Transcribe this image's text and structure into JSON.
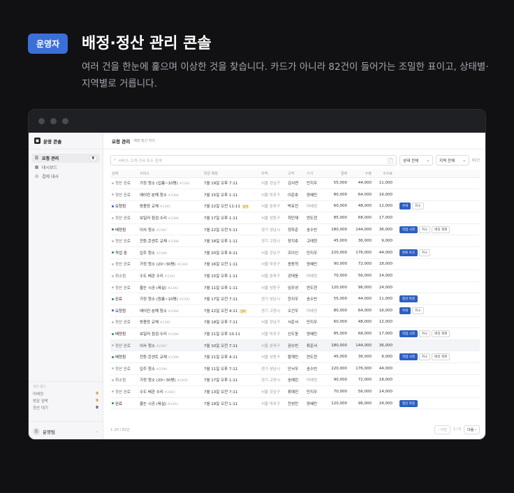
{
  "header": {
    "badge": "운영자",
    "title": "배정·정산 관리 콘솔",
    "subtitle": "여러 건을 한눈에 훑으며 이상한 것을 찾습니다. 카드가 아니라 82건이 들어가는 조밀한 표이고, 상태별·지역별로 거릅니다."
  },
  "sidebar": {
    "brand": "운영 콘솔",
    "items": [
      {
        "label": "요청 관리",
        "icon": "☰",
        "count": "9",
        "active": true
      },
      {
        "label": "대시보드",
        "icon": "▦",
        "count": "",
        "active": false
      },
      {
        "label": "결제 대사",
        "icon": "◎",
        "count": "",
        "active": false
      }
    ],
    "stats_title": "처리 대기",
    "stats": [
      {
        "label": "미배정",
        "value": "9",
        "color": "#c58a10"
      },
      {
        "label": "방문 임박",
        "value": "9",
        "color": "#c58a10"
      },
      {
        "label": "정산 대기",
        "value": "8",
        "color": "#333333"
      }
    ],
    "user": "운영팀"
  },
  "main": {
    "title": "요청 관리",
    "subtitle": "배정·정산 처리",
    "search_placeholder": "서비스·고객·기사·주소 검색",
    "search_kbd": "/",
    "status_filter": "상태 전체",
    "region_filter": "지역 전체",
    "count": "82건",
    "columns": [
      "상태",
      "서비스",
      "방문 예정",
      "지역",
      "고객",
      "기사",
      "결제",
      "수령",
      "수수료",
      ""
    ],
    "rows": [
      {
        "status": "정산 완료",
        "tone": "grey",
        "service": "가정 청소 (입룸~10평)",
        "id": "#2381",
        "visit": "7월 19일 오후 7:11",
        "urgent": "",
        "region": "서울 강남구",
        "customer": "김서연",
        "tech": "민지우",
        "pay": "55,000",
        "recv": "44,000",
        "fee": "11,000",
        "actions": []
      },
      {
        "status": "정산 완료",
        "tone": "grey",
        "service": "에어컨 분해 청소",
        "id": "#2384",
        "visit": "7월 15일 오후 1:11",
        "urgent": "",
        "region": "서울 마포구",
        "customer": "이준호",
        "tech": "양혜민",
        "pay": "80,000",
        "recv": "64,000",
        "fee": "16,000",
        "actions": []
      },
      {
        "status": "요청됨",
        "tone": "blue",
        "service": "방충망 교체",
        "id": "#2385",
        "visit": "7월 22일 오전 11:11",
        "urgent": "임박",
        "region": "서울 송파구",
        "customer": "박유진",
        "tech": "미배정",
        "pay": "60,000",
        "recv": "48,000",
        "fee": "12,000",
        "actions": [
          {
            "label": "수락",
            "primary": true
          },
          {
            "label": "취소",
            "primary": false
          }
        ]
      },
      {
        "status": "정산 완료",
        "tone": "grey",
        "service": "보일러 점검·수리",
        "id": "#2386",
        "visit": "7월 17일 오후 1:11",
        "urgent": "",
        "region": "서울 성동구",
        "customer": "최민재",
        "tech": "연도현",
        "pay": "85,000",
        "recv": "68,000",
        "fee": "17,000",
        "actions": []
      },
      {
        "status": "배정됨",
        "tone": "green",
        "service": "이사 청소",
        "id": "#2387",
        "visit": "7월 22일 오전 5:11",
        "urgent": "",
        "region": "경기 성남시",
        "customer": "정하준",
        "tech": "송수빈",
        "pay": "180,000",
        "recv": "144,000",
        "fee": "36,000",
        "actions": [
          {
            "label": "작업 시작",
            "primary": true
          },
          {
            "label": "취소",
            "primary": false
          },
          {
            "label": "배정 해제",
            "primary": false
          }
        ]
      },
      {
        "status": "정산 완료",
        "tone": "grey",
        "service": "전등·콘센트 교체",
        "id": "#2388",
        "visit": "7월 18일 오후 1:11",
        "urgent": "",
        "region": "경기 고양시",
        "customer": "장지호",
        "tech": "고태현",
        "pay": "45,000",
        "recv": "36,000",
        "fee": "9,000",
        "actions": []
      },
      {
        "status": "작업 중",
        "tone": "green",
        "service": "입주 청소",
        "id": "#2389",
        "visit": "7월 20일 오후 6:11",
        "urgent": "",
        "region": "서울 강남구",
        "customer": "조다인",
        "tech": "민지우",
        "pay": "220,000",
        "recv": "176,000",
        "fee": "44,000",
        "actions": [
          {
            "label": "완료 보고",
            "primary": true
          },
          {
            "label": "취소",
            "primary": false
          }
        ]
      },
      {
        "status": "정산 완료",
        "tone": "grey",
        "service": "가정 청소 (20~30평)",
        "id": "#2390",
        "visit": "7월 16일 오전 1:11",
        "urgent": "",
        "region": "서울 마포구",
        "customer": "윤동혁",
        "tech": "양혜민",
        "pay": "90,000",
        "recv": "72,000",
        "fee": "18,000",
        "actions": []
      },
      {
        "status": "취소됨",
        "tone": "grey",
        "service": "수도 배관 수리",
        "id": "#2391",
        "visit": "7월 15일 오후 1:11",
        "urgent": "",
        "region": "서울 송파구",
        "customer": "강태윤",
        "tech": "미배정",
        "pay": "70,000",
        "recv": "56,000",
        "fee": "14,000",
        "actions": []
      },
      {
        "status": "정산 완료",
        "tone": "grey",
        "service": "줄눈 시공 (욕실)",
        "id": "#2392",
        "visit": "7월 11일 오후 1:11",
        "urgent": "",
        "region": "서울 성동구",
        "customer": "임우성",
        "tech": "연도현",
        "pay": "120,000",
        "recv": "96,000",
        "fee": "24,000",
        "actions": []
      },
      {
        "status": "완료",
        "tone": "green",
        "service": "가정 청소 (원룸~10평)",
        "id": "#2393",
        "visit": "7월 17일 오전 7:11",
        "urgent": "",
        "region": "경기 성남시",
        "customer": "한지우",
        "tech": "송수빈",
        "pay": "55,000",
        "recv": "44,000",
        "fee": "11,000",
        "actions": [
          {
            "label": "정산 마감",
            "primary": true
          }
        ]
      },
      {
        "status": "요청됨",
        "tone": "blue",
        "service": "에어컨 분해 청소",
        "id": "#2394",
        "visit": "7월 22일 오전 4:11",
        "urgent": "임박",
        "region": "경기 고양시",
        "customer": "오건우",
        "tech": "미배정",
        "pay": "80,000",
        "recv": "64,000",
        "fee": "16,000",
        "actions": [
          {
            "label": "수락",
            "primary": true
          },
          {
            "label": "취소",
            "primary": false
          }
        ]
      },
      {
        "status": "정산 완료",
        "tone": "grey",
        "service": "방충망 교체",
        "id": "#2395",
        "visit": "7월 18일 오후 7:11",
        "urgent": "",
        "region": "서울 강남구",
        "customer": "서준서",
        "tech": "민지우",
        "pay": "60,000",
        "recv": "48,000",
        "fee": "12,000",
        "actions": []
      },
      {
        "status": "배정됨",
        "tone": "green",
        "service": "보일러 점검·수리",
        "id": "#2396",
        "visit": "7월 21일 오후 10:11",
        "urgent": "",
        "region": "서울 마포구",
        "customer": "신도윤",
        "tech": "양혜민",
        "pay": "85,000",
        "recv": "68,000",
        "fee": "17,000",
        "actions": [
          {
            "label": "작업 시작",
            "primary": true
          },
          {
            "label": "취소",
            "primary": false
          },
          {
            "label": "배정 해제",
            "primary": false
          }
        ]
      },
      {
        "status": "정산 완료",
        "tone": "grey",
        "service": "이사 청소",
        "id": "#2397",
        "visit": "7월 10일 오전 7:11",
        "urgent": "",
        "region": "서울 송파구",
        "customer": "권수빈",
        "tech": "류준서",
        "pay": "180,000",
        "recv": "144,000",
        "fee": "36,000",
        "actions": [],
        "highlight": true
      },
      {
        "status": "배정됨",
        "tone": "green",
        "service": "전등·콘센트 교체",
        "id": "#2398",
        "visit": "7월 21일 오후 4:11",
        "urgent": "",
        "region": "서울 성동구",
        "customer": "황재민",
        "tech": "연도현",
        "pay": "45,000",
        "recv": "36,000",
        "fee": "9,000",
        "actions": [
          {
            "label": "작업 시작",
            "primary": true
          },
          {
            "label": "취소",
            "primary": false
          },
          {
            "label": "배정 해제",
            "primary": false
          }
        ]
      },
      {
        "status": "정산 완료",
        "tone": "grey",
        "service": "입주 청소",
        "id": "#2399",
        "visit": "7월 11일 오후 7:11",
        "urgent": "",
        "region": "경기 성남시",
        "customer": "안서우",
        "tech": "송수빈",
        "pay": "220,000",
        "recv": "176,000",
        "fee": "44,000",
        "actions": []
      },
      {
        "status": "취소됨",
        "tone": "grey",
        "service": "가정 청소 (20~30평)",
        "id": "#2400",
        "visit": "7월 17일 오후 1:11",
        "urgent": "",
        "region": "경기 고양시",
        "customer": "송예린",
        "tech": "미배정",
        "pay": "90,000",
        "recv": "72,000",
        "fee": "18,000",
        "actions": []
      },
      {
        "status": "정산 완료",
        "tone": "grey",
        "service": "수도 배관 수리",
        "id": "#2401",
        "visit": "7월 13일 오전 7:11",
        "urgent": "",
        "region": "서울 강남구",
        "customer": "류예진",
        "tech": "민지우",
        "pay": "70,000",
        "recv": "56,000",
        "fee": "14,000",
        "actions": []
      },
      {
        "status": "완료",
        "tone": "green",
        "service": "줄눈 시공 (욕실)",
        "id": "#2402",
        "visit": "7월 19일 오전 1:11",
        "urgent": "",
        "region": "서울 마포구",
        "customer": "전성민",
        "tech": "양혜민",
        "pay": "120,000",
        "recv": "96,000",
        "fee": "24,000",
        "actions": [
          {
            "label": "정산 마감",
            "primary": true
          }
        ]
      }
    ],
    "pager": {
      "range": "1–20 / 82건",
      "prev": "‹ 이전",
      "page": "1 / 5",
      "next": "다음 ›"
    }
  }
}
